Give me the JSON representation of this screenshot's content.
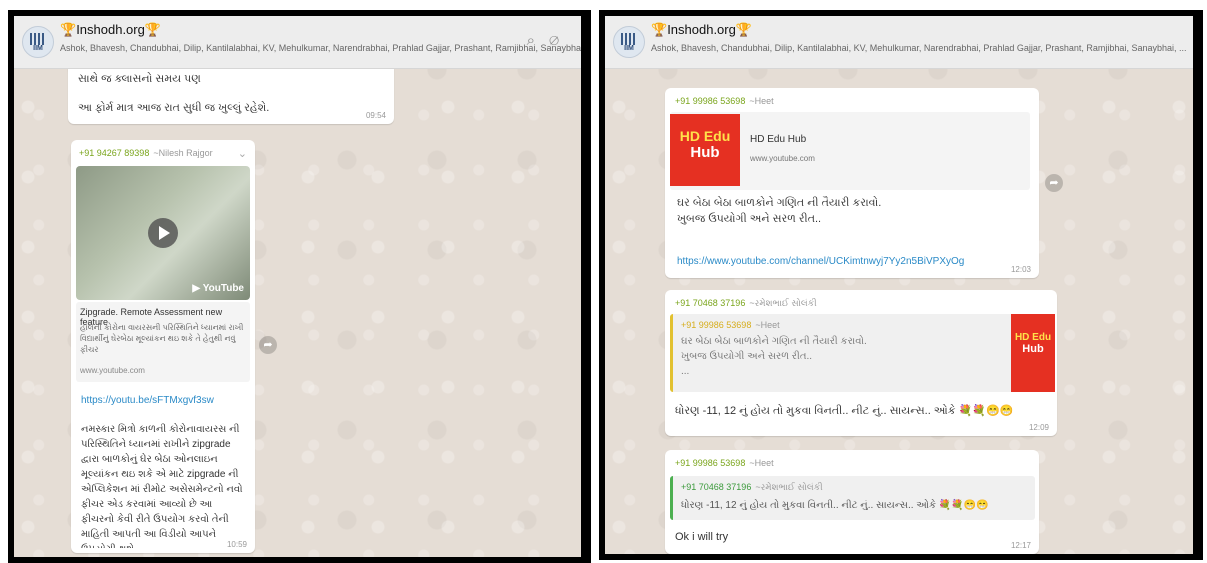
{
  "left": {
    "header": {
      "group_name": "Inshodh.org",
      "members": "Ashok, Bhavesh, Chandubhai, Dilip, Kantilalabhai, KV, Mehulkumar, Narendrabhai, Prahlad Gajjar, Prashant, Ramjibhai, Sanaybha, ...",
      "avatar_text": "IIM"
    },
    "msg1": {
      "line1": "સાથે જ ક્લાસનો સમય પણ",
      "line2": "આ ફોર્મ માત્ર આજ રાત સુધી જ ખુલ્લું રહેશે.",
      "time": "09:54"
    },
    "msg2": {
      "phone": "+91 94267 89398",
      "sender_name": "~Nilesh Rajgor",
      "video_brand": "YouTube",
      "preview_title": "Zipgrade. Remote Assessment new feature",
      "preview_desc": "હાલની કોરોના વાયરસની પરિસ્થિતિને ધ્યાનમાં રાખી વિદ્યાર્થીનું ઘેરબેઠા મૂલ્યાંકન થઇ શકે તે હેતુથી નવું ફીચર",
      "preview_domain": "www.youtube.com",
      "link": "https://youtu.be/sFTMxgvf3sw",
      "body": "નમસ્કાર મિત્રો કાળની કોરોનાવાયરસ ની પરિસ્થિતિને ધ્યાનમાં રાખીને zipgrade દ્વારા બાળકોનું ઘેર બેઠા ઓનલાઇન મૂલ્યાંકન થઇ શકે એ માટે zipgrade ની એપ્લિકેશન માં રીમોટ અસેસમેન્ટનો નવો ફીચર એડ કરવામાં આવ્યો છે આ ફીચરનો કેવી રીતે ઉપયોગ કરવો તેની માહિતી આપતી આ વિડીયો આપને ઉપયોગી થશે",
      "time": "10:59"
    }
  },
  "right": {
    "header": {
      "group_name": "Inshodh.org",
      "members": "Ashok, Bhavesh, Chandubhai, Dilip, Kantilalabhai, KV, Mehulkumar, Narendrabhai, Prahlad Gajjar, Prashant, Ramjibhai, Sanaybhai, ...",
      "avatar_text": "IIM"
    },
    "msg1": {
      "phone": "+91 99986 53698",
      "sender_name": "~Heet",
      "logo_top": "HD Edu",
      "logo_bottom": "Hub",
      "preview_title": "HD Edu Hub",
      "preview_domain": "www.youtube.com",
      "body_line1": "ઘર બેઠા બેઠા બાળકોને ગણિત ની તૈયારી કરાવો.",
      "body_line2": "ખુબજ ઉપયોગી અને સરળ રીત..",
      "link": "https://www.youtube.com/channel/UCKimtnwyj7Yy2n5BiVPXyOg",
      "time": "12:03"
    },
    "msg2": {
      "phone": "+91 70468 37196",
      "sender_name": "~રમેશભાઈ સોલંકી",
      "quote_phone": "+91 99986 53698",
      "quote_name": "~Heet",
      "quote_line1": "ઘર બેઠા બેઠા બાળકોને ગણિત ની તૈયારી કરાવો.",
      "quote_line2": "ખુબજ ઉપયોગી અને સરળ રીત..",
      "quote_line3": "...",
      "logo_top": "HD Edu",
      "logo_bottom": "Hub",
      "body": "ધોરણ -11, 12 નું હોય તો મુકવા વિનતી.. નીટ નું.. સાયન્સ.. ઓકે",
      "emoji": "💐💐😁😁",
      "time": "12:09"
    },
    "msg3": {
      "phone": "+91 99986 53698",
      "sender_name": "~Heet",
      "quote_phone": "+91 70468 37196",
      "quote_name": "~રમેશભાઈ સોલંકી",
      "quote_text": "ધોરણ -11, 12 નું હોય તો મુકવા વિનતી.. નીટ નું.. સાયન્સ.. ઓકે",
      "quote_emoji": "💐💐😁😁",
      "body": "Ok i will try",
      "time": "12:17"
    }
  }
}
